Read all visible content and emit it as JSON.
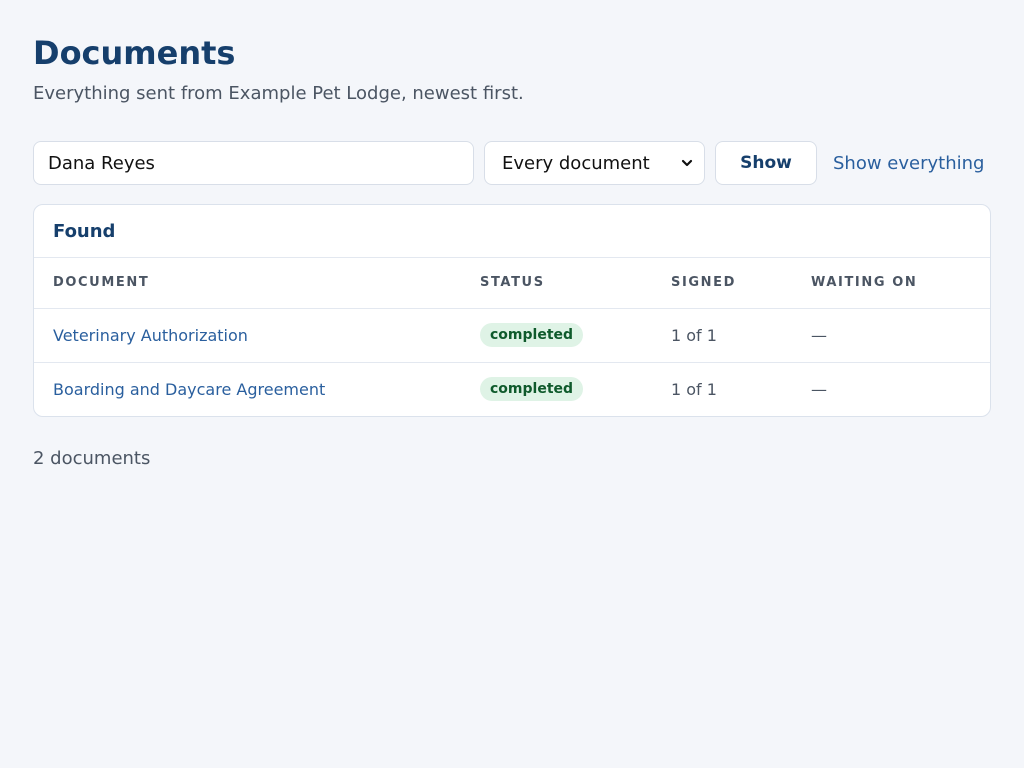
{
  "header": {
    "title": "Documents",
    "subtitle": "Everything sent from Example Pet Lodge, newest first."
  },
  "filters": {
    "search_value": "Dana Reyes",
    "type_selected": "Every document",
    "show_label": "Show",
    "show_all_label": "Show everything"
  },
  "results": {
    "title": "Found",
    "columns": [
      "Document",
      "Status",
      "Signed",
      "Waiting on"
    ],
    "rows": [
      {
        "document": "Veterinary Authorization",
        "status": "completed",
        "signed": "1 of 1",
        "waiting_on": "—"
      },
      {
        "document": "Boarding and Daycare Agreement",
        "status": "completed",
        "signed": "1 of 1",
        "waiting_on": "—"
      }
    ]
  },
  "footer": {
    "count": "2 documents"
  },
  "colors": {
    "accent": "#163f6c",
    "link": "#2a5f9e",
    "badge_bg": "#dff3e6",
    "badge_text": "#0f5a2c"
  }
}
